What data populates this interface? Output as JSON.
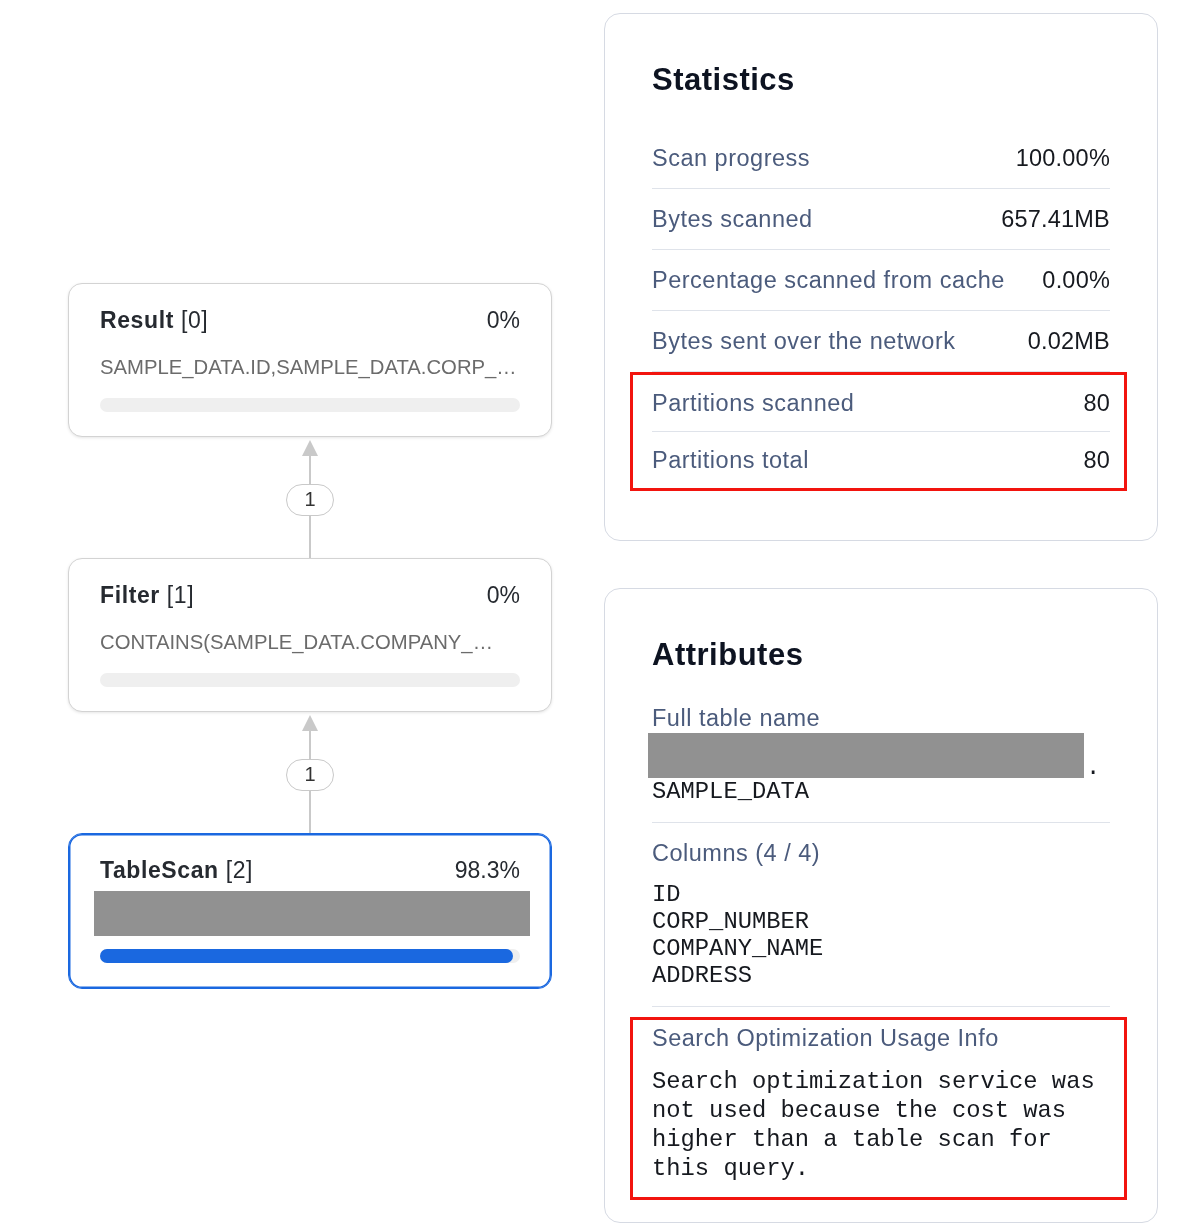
{
  "plan": {
    "nodes": [
      {
        "title": "**Result** [0]",
        "percent": "0%",
        "detail": "SAMPLE_DATA.ID,SAMPLE_DATA.CORP_…",
        "redacted": false,
        "selected": false
      },
      {
        "title": "**Filter** [1]",
        "percent": "0%",
        "detail": "CONTAINS(SAMPLE_DATA.COMPANY_…",
        "redacted": false,
        "selected": false
      },
      {
        "title": "**TableScan** [2]",
        "percent": "98.3%",
        "redacted": true,
        "level": 0.983,
        "selected": true
      }
    ],
    "edges": [
      {
        "label": "1"
      },
      {
        "label": "1"
      }
    ]
  },
  "statistics": {
    "title": "Statistics",
    "sections": [
      {
        "highlighted": false,
        "rows": [
          {
            "label": "Scan progress",
            "value": "100.00%"
          },
          {
            "label": "Bytes scanned",
            "value": "657.41MB"
          },
          {
            "label": "Percentage scanned from cache",
            "value": "0.00%"
          },
          {
            "label": "Bytes sent over the network",
            "value": "0.02MB"
          }
        ]
      },
      {
        "highlighted": true,
        "rows": [
          {
            "label": "Partitions scanned",
            "value": "80"
          },
          {
            "label": "Partitions total",
            "value": "80"
          }
        ]
      }
    ]
  },
  "attributes": {
    "title": "Attributes",
    "items": [
      {
        "kind": "table_name",
        "label": "Full table name",
        "redacted": true,
        "separator": ".",
        "value": "SAMPLE_DATA",
        "highlighted": false
      },
      {
        "kind": "list",
        "label": "Columns (4 / 4)",
        "values": [
          "ID",
          "CORP_NUMBER",
          "COMPANY_NAME",
          "ADDRESS"
        ],
        "highlighted": false
      },
      {
        "kind": "note",
        "label": "Search Optimization Usage Info",
        "text": "Search optimization service was not used because the cost was higher than a table scan for this query.",
        "highlighted": true
      }
    ]
  }
}
